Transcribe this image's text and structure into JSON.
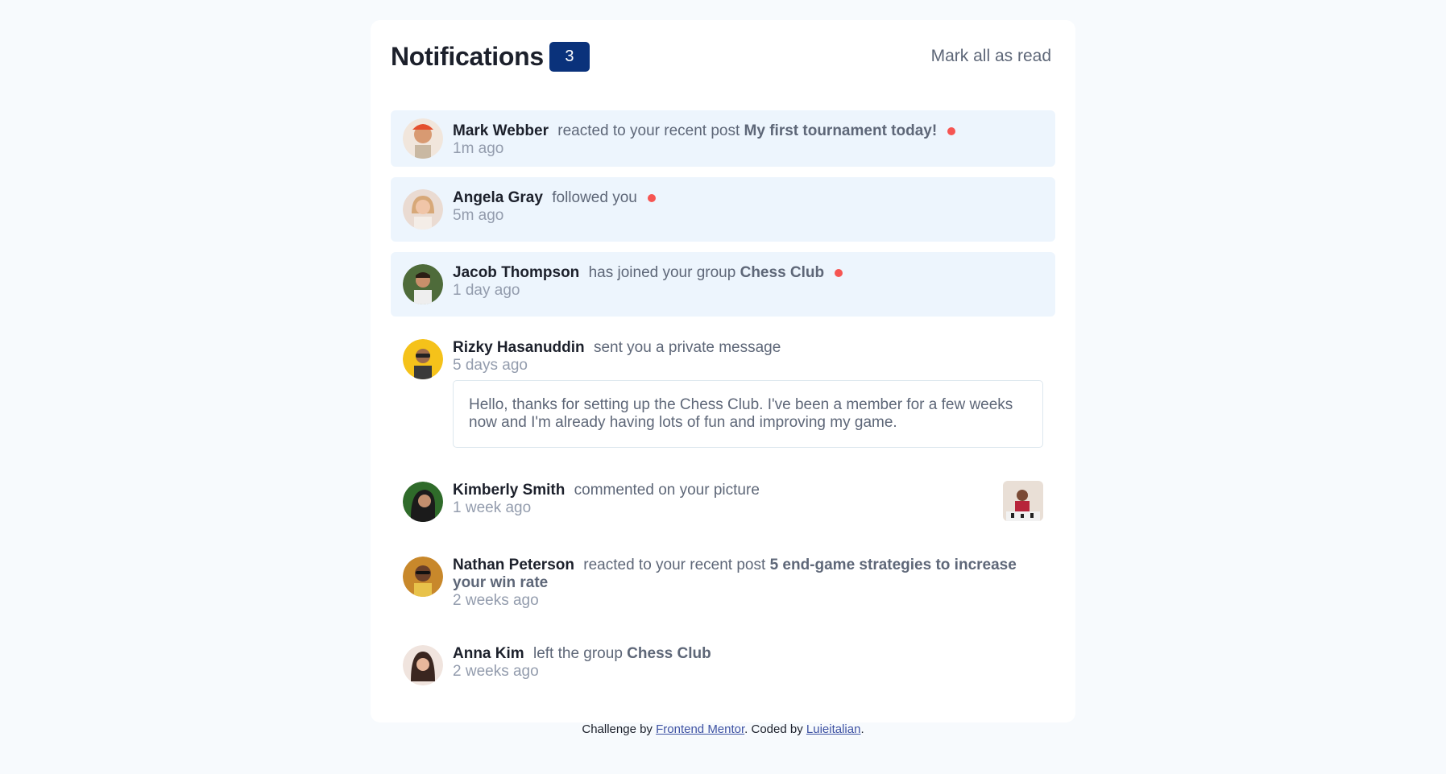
{
  "header": {
    "title": "Notifications",
    "unread_count": "3",
    "mark_all_label": "Mark all as read"
  },
  "notifications": [
    {
      "name": "Mark Webber",
      "action": "reacted to your recent post",
      "target": "My first tournament today!",
      "time": "1m ago",
      "unread": true
    },
    {
      "name": "Angela Gray",
      "action": "followed you",
      "target": "",
      "time": "5m ago",
      "unread": true
    },
    {
      "name": "Jacob Thompson",
      "action": "has joined your group",
      "target": "Chess Club",
      "time": "1 day ago",
      "unread": true
    },
    {
      "name": "Rizky Hasanuddin",
      "action": "sent you a private message",
      "target": "",
      "time": "5 days ago",
      "unread": false,
      "message": "Hello, thanks for setting up the Chess Club. I've been a member for a few weeks now and I'm already having lots of fun and improving my game."
    },
    {
      "name": "Kimberly Smith",
      "action": "commented on your picture",
      "target": "",
      "time": "1 week ago",
      "unread": false
    },
    {
      "name": "Nathan Peterson",
      "action": "reacted to your recent post",
      "target": "5 end-game strategies to increase your win rate",
      "time": "2 weeks ago",
      "unread": false
    },
    {
      "name": "Anna Kim",
      "action": "left the group",
      "target": "Chess Club",
      "time": "2 weeks ago",
      "unread": false
    }
  ],
  "footer": {
    "prefix": "Challenge by",
    "link1": "Frontend Mentor",
    "middle": ". Coded by",
    "link2": "Luieitalian",
    "suffix": "."
  },
  "colors": {
    "unread_bg": "#edf5fd",
    "badge": "#0a327b",
    "dot": "#f65552",
    "text_dark": "#1c202b",
    "text_muted": "#939cad"
  }
}
